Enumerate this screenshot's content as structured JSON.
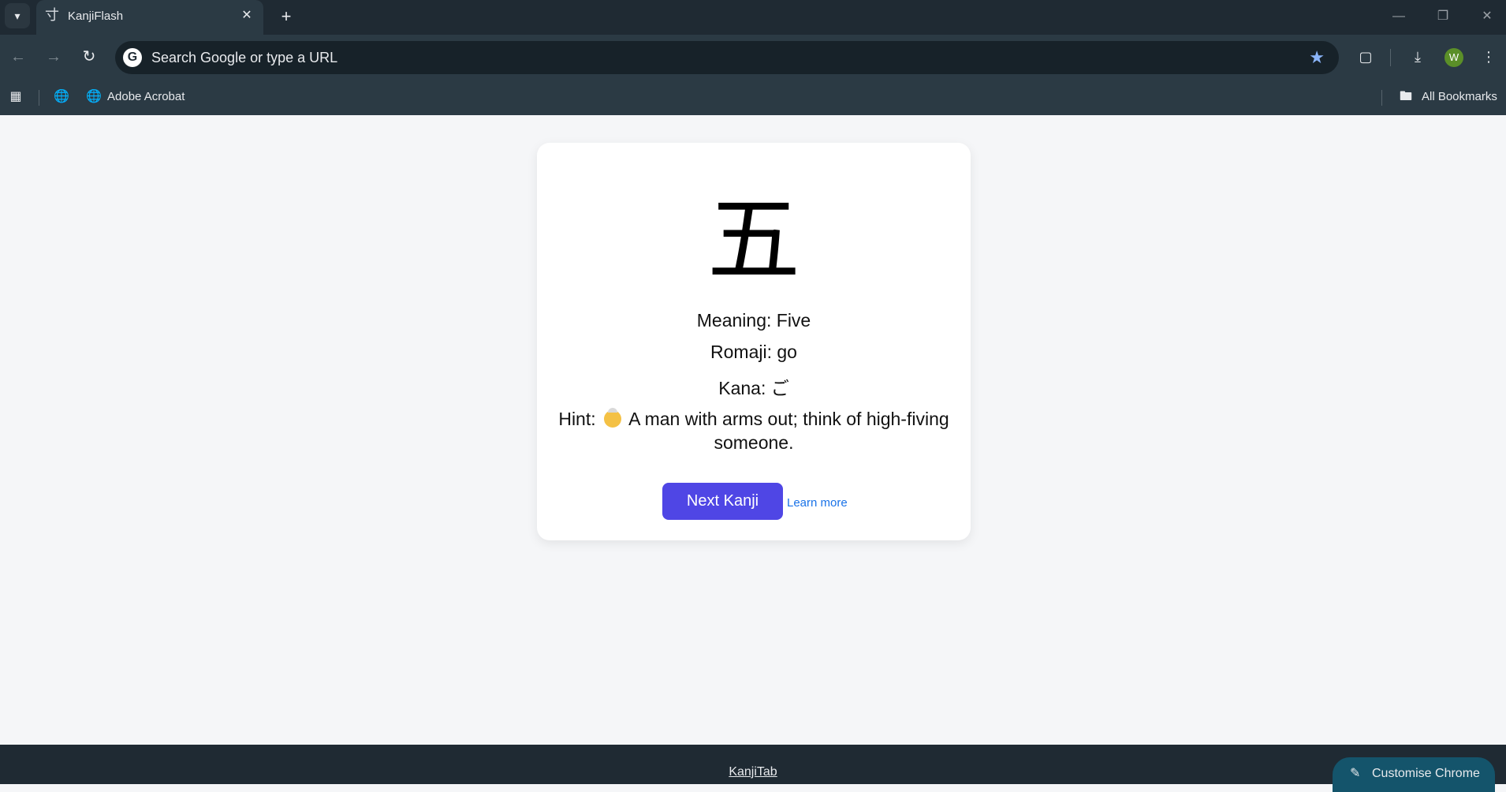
{
  "browser": {
    "tab_menu_icon": "chevron-down-icon",
    "tab": {
      "title": "KanjiFlash",
      "favicon": "kanji-favicon",
      "close_icon": "close-icon"
    },
    "new_tab_icon": "plus-icon",
    "window_controls": [
      "minimize-icon",
      "restore-icon",
      "close-icon"
    ],
    "omnibox": {
      "placeholder": "Search Google or type a URL"
    },
    "toolbar_icons": [
      "back-arrow-icon",
      "forward-arrow-icon",
      "reload-icon",
      "bookmark-star-icon",
      "extensions-icon",
      "download-icon",
      "more-menu-icon"
    ],
    "profile_initial": "W",
    "bookmarks": {
      "apps_icon": "apps-grid-icon",
      "globe_icon": "globe-icon",
      "adobe_label": "Adobe Acrobat",
      "all_bookmarks_label": "All Bookmarks"
    }
  },
  "card": {
    "kanji": "五",
    "meaning": "Meaning: Five",
    "romaji": "Romaji: go",
    "kana": "Kana: ご",
    "hint_prefix": "Hint:",
    "hint_text": "A man with arms out; think of high-fiving someone.",
    "hint_emoji": "older-man-emoji",
    "next_button": "Next Kanji",
    "learn_more": "Learn more"
  },
  "footer": {
    "link_text": "KanjiTab",
    "customise_label": "Customise Chrome",
    "customise_icon": "pencil-icon"
  },
  "colors": {
    "accent_button": "#4f46e5",
    "link": "#1a73e8",
    "chrome_dark": "#1f2a33",
    "chrome_toolbar": "#2b3a44",
    "page_bg": "#f5f6f8"
  }
}
